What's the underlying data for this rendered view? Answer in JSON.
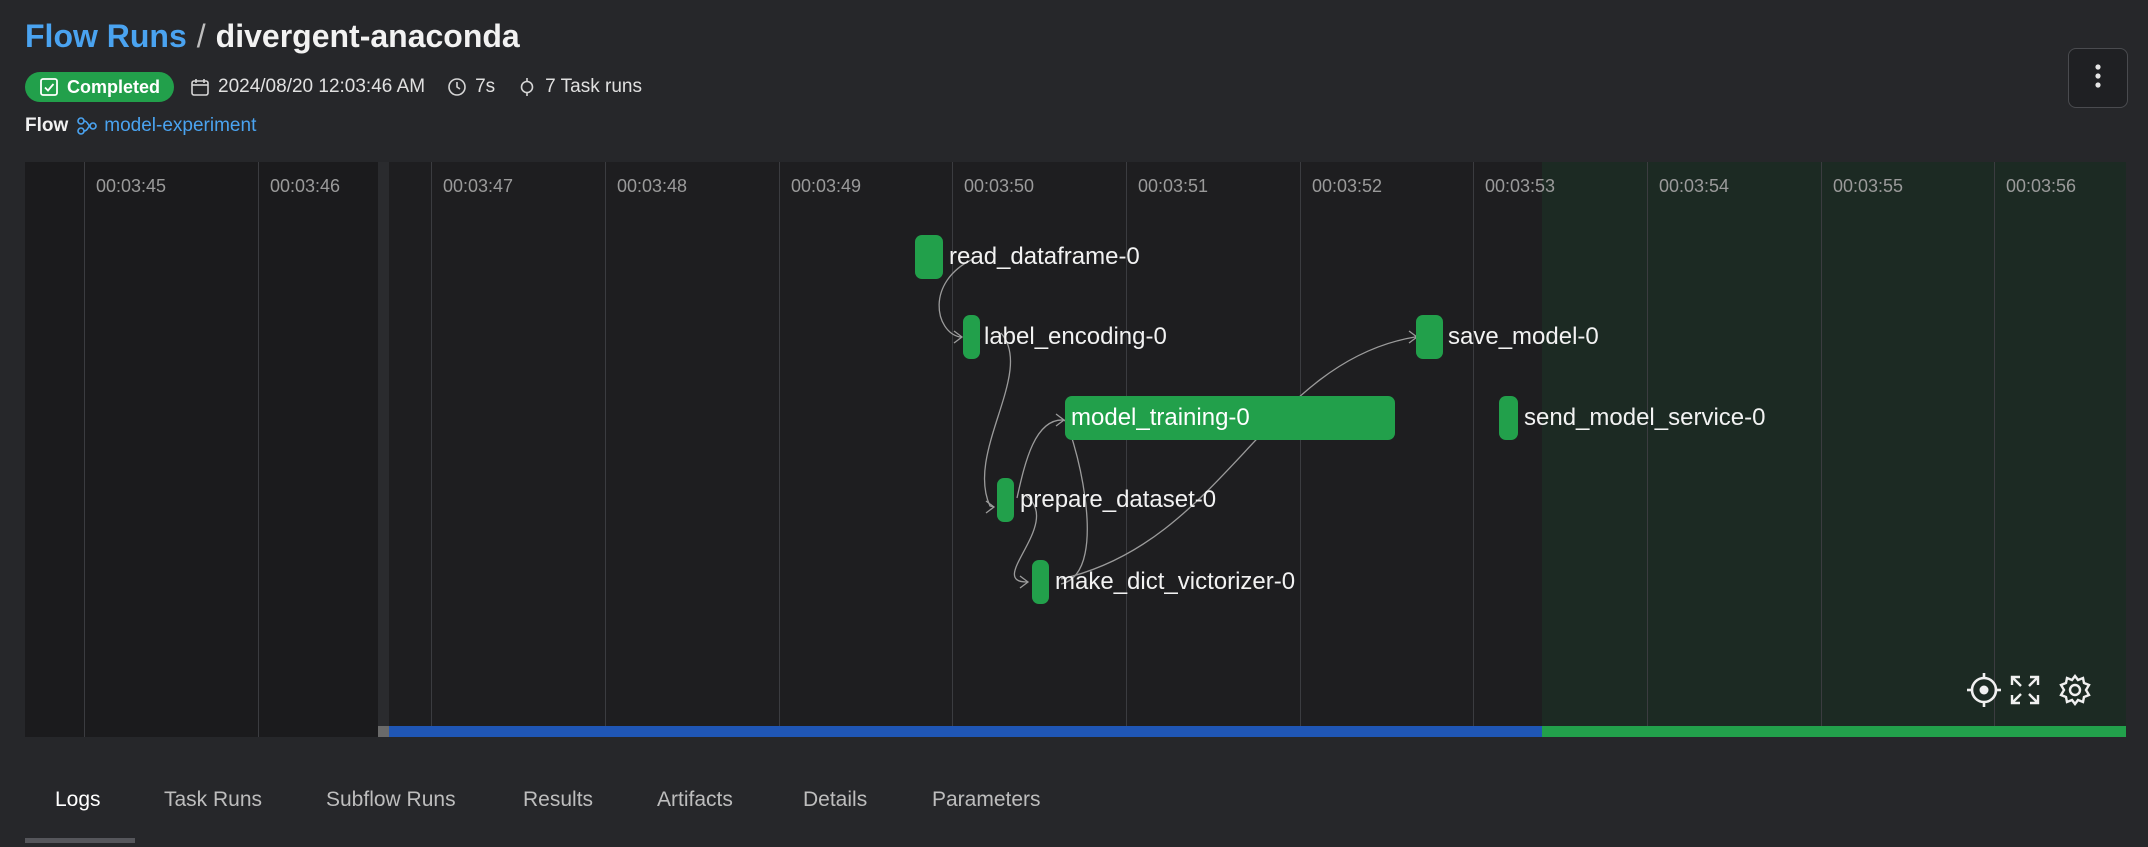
{
  "breadcrumb": {
    "parent": "Flow Runs",
    "separator": "/",
    "current": "divergent-anaconda"
  },
  "status": {
    "label": "Completed",
    "color": "#22a04b"
  },
  "meta": {
    "date": "2024/08/20 12:03:46 AM",
    "duration": "7s",
    "task_runs": "7 Task runs"
  },
  "flow": {
    "label": "Flow",
    "name": "model-experiment"
  },
  "timeline": {
    "ticks": [
      "00:03:45",
      "00:03:46",
      "00:03:47",
      "00:03:48",
      "00:03:49",
      "00:03:50",
      "00:03:51",
      "00:03:52",
      "00:03:53",
      "00:03:54",
      "00:03:55",
      "00:03:56"
    ],
    "nodes": [
      {
        "name": "read_dataframe-0",
        "state": "Completed"
      },
      {
        "name": "label_encoding-0",
        "state": "Completed"
      },
      {
        "name": "model_training-0",
        "state": "Completed"
      },
      {
        "name": "prepare_dataset-0",
        "state": "Completed"
      },
      {
        "name": "make_dict_victorizer-0",
        "state": "Completed"
      },
      {
        "name": "save_model-0",
        "state": "Completed"
      },
      {
        "name": "send_model_service-0",
        "state": "Completed"
      }
    ],
    "controls": [
      "recenter-icon",
      "fullscreen-icon",
      "settings-icon"
    ]
  },
  "tabs": [
    "Logs",
    "Task Runs",
    "Subflow Runs",
    "Results",
    "Artifacts",
    "Details",
    "Parameters"
  ],
  "active_tab": "Logs",
  "colors": {
    "accent": "#4aa3f0",
    "success": "#22a04b",
    "progress_blue": "#1f56b5"
  }
}
